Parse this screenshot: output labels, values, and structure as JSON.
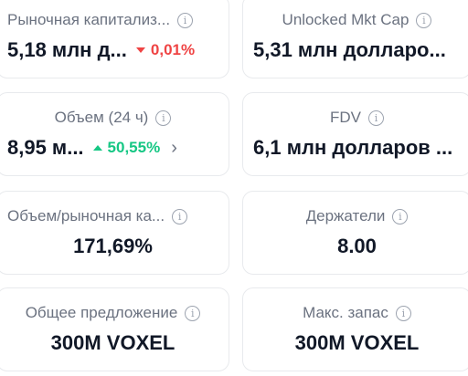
{
  "stats": {
    "market_cap": {
      "label": "Рыночная капитализ...",
      "value": "5,18 млн д...",
      "change": "0,01%",
      "direction": "down"
    },
    "unlocked_mkt_cap": {
      "label": "Unlocked Mkt Cap",
      "value": "5,31 млн долларо..."
    },
    "volume_24h": {
      "label": "Объем (24 ч)",
      "value": "8,95 м...",
      "change": "50,55%",
      "direction": "up"
    },
    "fdv": {
      "label": "FDV",
      "value": "6,1 млн долларов ..."
    },
    "volume_market_cap": {
      "label": "Объем/рыночная ка...",
      "value": "171,69%"
    },
    "holders": {
      "label": "Держатели",
      "value": "8.00"
    },
    "total_supply": {
      "label": "Общее предложение",
      "value": "300M VOXEL"
    },
    "max_supply": {
      "label": "Макс. запас",
      "value": "300M VOXEL"
    }
  },
  "icons": {
    "info": "info-circle-icon",
    "chevron": "chevron-right-icon",
    "down": "triangle-down-icon",
    "up": "triangle-up-icon"
  },
  "colors": {
    "negative": "#ef4444",
    "positive": "#16c784",
    "label": "#6b7280",
    "value": "#111827",
    "border": "#e8eaed"
  }
}
